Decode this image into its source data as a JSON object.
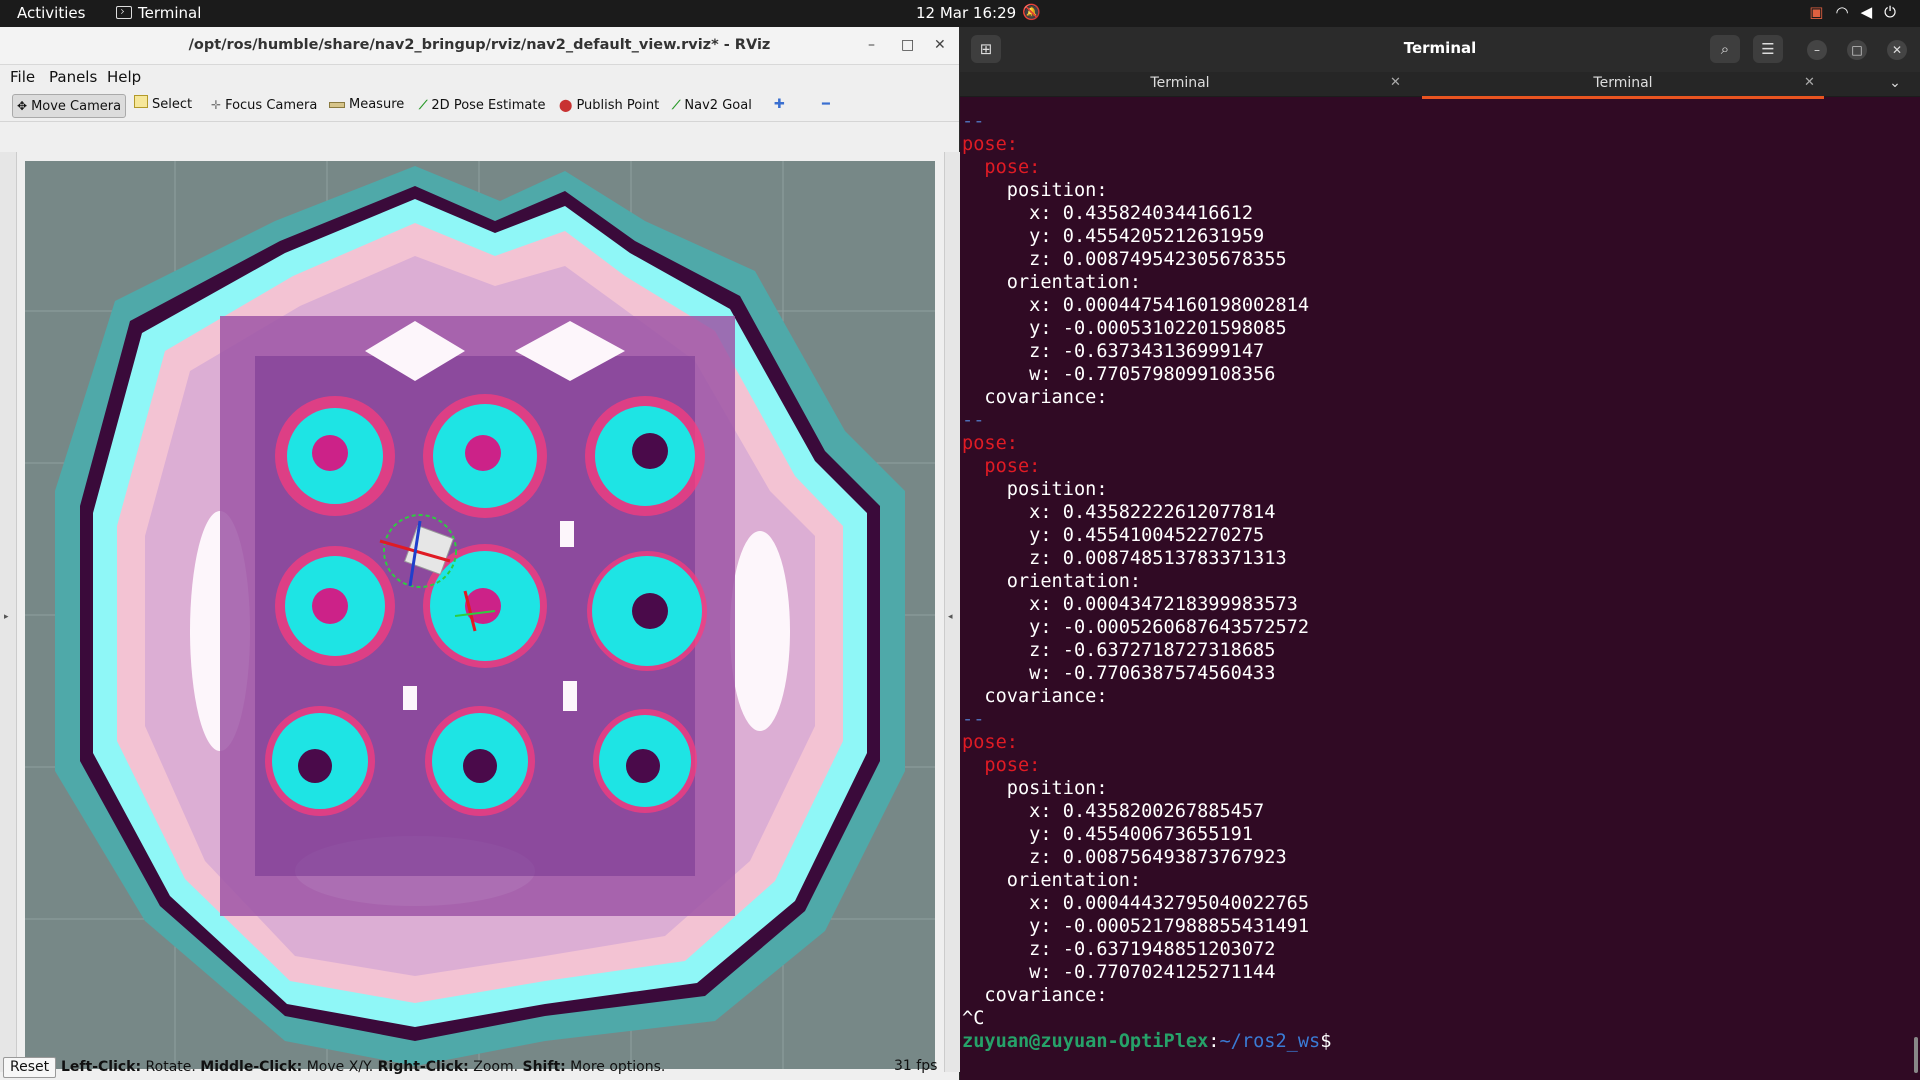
{
  "topbar": {
    "activities": "Activities",
    "app_name": "Terminal",
    "datetime": "12 Mar  16:29"
  },
  "rviz": {
    "title": "/opt/ros/humble/share/nav2_bringup/rviz/nav2_default_view.rviz* - RViz",
    "menu": [
      "File",
      "Panels",
      "Help"
    ],
    "tools": [
      {
        "label": "Move Camera",
        "icon": "move-camera-icon"
      },
      {
        "label": "Select",
        "icon": "select-icon"
      },
      {
        "label": "Focus Camera",
        "icon": "focus-camera-icon"
      },
      {
        "label": "Measure",
        "icon": "measure-icon"
      },
      {
        "label": "2D Pose Estimate",
        "icon": "pose-estimate-icon"
      },
      {
        "label": "Publish Point",
        "icon": "map-pin-icon"
      },
      {
        "label": "Nav2 Goal",
        "icon": "nav-goal-icon"
      }
    ],
    "status": {
      "reset": "Reset",
      "hint": [
        {
          "b": "Left-Click:",
          "t": " Rotate. "
        },
        {
          "b": "Middle-Click:",
          "t": " Move X/Y. "
        },
        {
          "b": "Right-Click:",
          "t": " Zoom. "
        },
        {
          "b": "Shift:",
          "t": " More options."
        }
      ],
      "fps": "31 fps"
    }
  },
  "terminal": {
    "title": "Terminal",
    "tabs": [
      "Terminal",
      "Terminal"
    ],
    "active_tab": 1,
    "prompt": {
      "user": "zuyuan@zuyuan-OptiPlex",
      "path": "~/ros2_ws",
      "symbol": "$"
    },
    "interrupt": "^C",
    "messages": [
      {
        "pos": {
          "x": "0.435824034416612",
          "y": "0.4554205212631959",
          "z": "0.008749542305678355"
        },
        "ori": {
          "x": "0.00044754160198002814",
          "y": "-0.00053102201598085",
          "z": "-0.637343136999147",
          "w": "-0.7705798099108356"
        }
      },
      {
        "pos": {
          "x": "0.43582222612077814",
          "y": "0.4554100452270275",
          "z": "0.008748513783371313"
        },
        "ori": {
          "x": "0.0004347218399983573",
          "y": "-0.0005260687643572572",
          "z": "-0.6372718727318685",
          "w": "-0.7706387574560433"
        }
      },
      {
        "pos": {
          "x": "0.4358200267885457",
          "y": "0.455400673655191",
          "z": "0.008756493873767923"
        },
        "ori": {
          "x": "0.00044432795040022765",
          "y": "-0.0005217988855431491",
          "z": "-0.6371948851203072",
          "w": "-0.7707024125271144"
        }
      }
    ]
  }
}
